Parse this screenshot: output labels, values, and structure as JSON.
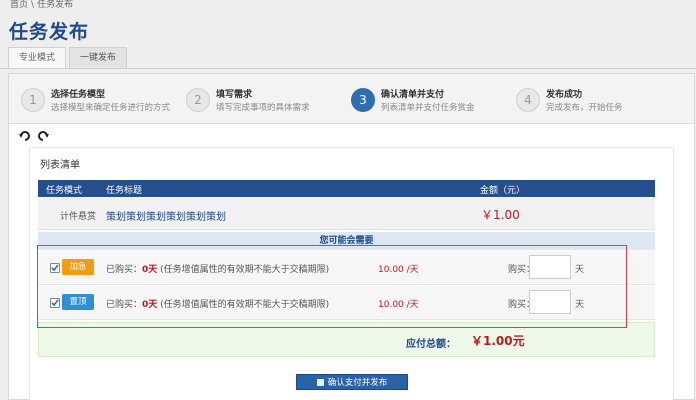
{
  "breadcrumb": {
    "home": "首页",
    "separator": "\\",
    "current": "任务发布"
  },
  "page_title": "任务发布",
  "tabs": [
    {
      "label": "专业模式",
      "active": true
    },
    {
      "label": "一键发布",
      "active": false
    }
  ],
  "steps": [
    {
      "num": "1",
      "title": "选择任务模型",
      "desc": "选择模型来确定任务进行的方式",
      "active": false
    },
    {
      "num": "2",
      "title": "填写需求",
      "desc": "填写完成事项的具体需求",
      "active": false
    },
    {
      "num": "3",
      "title": "确认清单并支付",
      "desc": "列表清单并支付任务赏金",
      "active": true
    },
    {
      "num": "4",
      "title": "发布成功",
      "desc": "完成发布，开始任务",
      "active": false
    }
  ],
  "list": {
    "title": "列表清单",
    "columns": {
      "mode": "任务模式",
      "title": "任务标题",
      "amount": "金额（元）"
    },
    "row": {
      "mode": "计件悬赏",
      "title": "策划策划策划策划策划策划",
      "amount": "￥1.00"
    },
    "addon_header": "您可能会需要",
    "addons": [
      {
        "badge": "加急",
        "badge_color": "#f39c12",
        "checked": true,
        "bought_prefix": "已购买：",
        "bought_value": "0天",
        "note": "(任务增值属性的有效期不能大于交稿期限)",
        "price": "10.00 /天",
        "buy_label": "购买：",
        "buy_value": "",
        "unit": "天"
      },
      {
        "badge": "置顶",
        "badge_color": "#2f8fd0",
        "checked": true,
        "bought_prefix": "已购买：",
        "bought_value": "0天",
        "note": "(任务增值属性的有效期不能大于交稿期限)",
        "price": "10.00 /天",
        "buy_label": "购买：",
        "buy_value": "",
        "unit": "天"
      }
    ],
    "total_label": "应付总额：",
    "total_amount": "￥1.00元"
  },
  "submit_label": "确认支付并发布",
  "colors": {
    "brand": "#1f4a8c",
    "header": "#264d8c",
    "price": "#c0181e",
    "highlight": "#d0434c"
  }
}
